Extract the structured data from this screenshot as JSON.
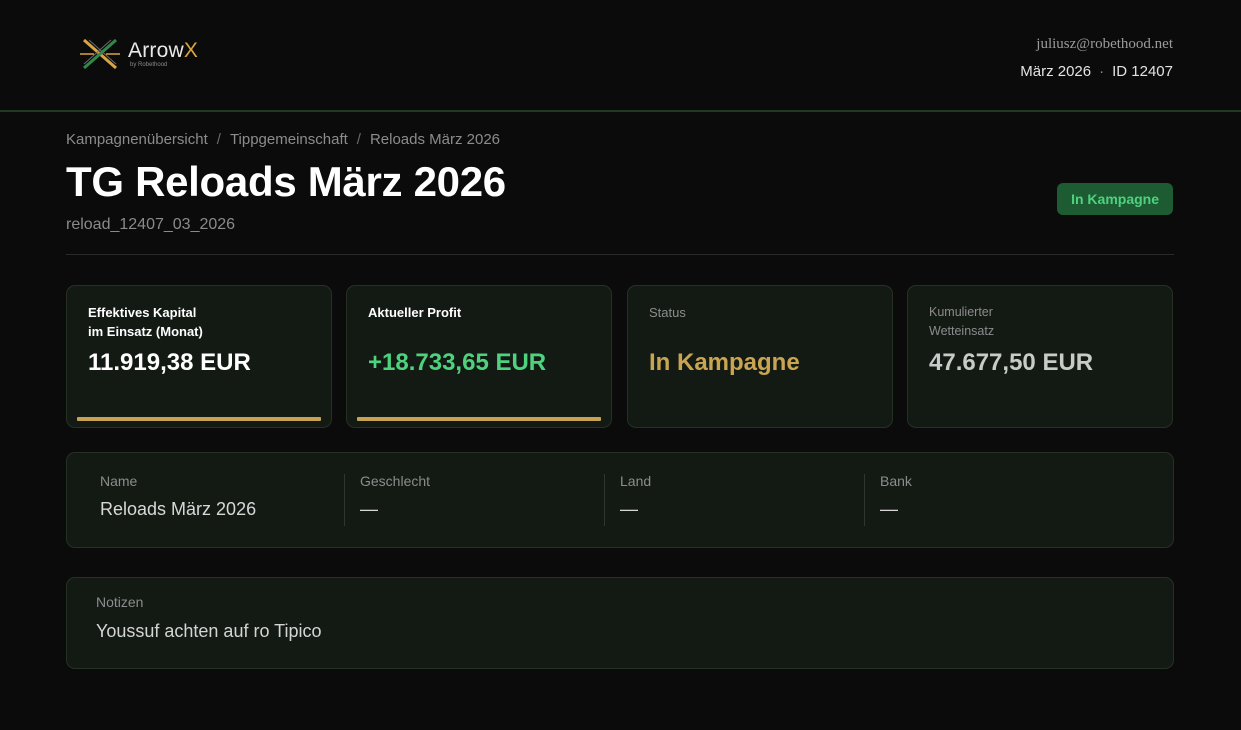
{
  "brand": {
    "name_main": "Arrow",
    "name_accent": "X",
    "tagline": "by Robethood",
    "colors": {
      "accent": "#d9a441",
      "green": "#4fd27e",
      "gold": "#c7a253"
    }
  },
  "user": {
    "email": "juliusz@robethood.net",
    "period": "März 2026",
    "separator": "·",
    "id": "ID 12407"
  },
  "breadcrumb": [
    "Kampagnenübersicht",
    "Tippgemeinschaft",
    "Reloads März 2026"
  ],
  "page": {
    "title": "TG Reloads März 2026",
    "slug": "reload_12407_03_2026",
    "status_badge": "In Kampagne"
  },
  "cards": [
    {
      "label_line1": "Effektives Kapital",
      "label_line2": "im Einsatz (Monat)",
      "value": "11.919,38 EUR",
      "value_color": "#ffffff"
    },
    {
      "label_line1": "Aktueller Profit",
      "value": "+18.733,65 EUR",
      "value_color": "#4fd27e"
    },
    {
      "label_line1": "Status",
      "value": "In Kampagne",
      "value_color": "#c9a552"
    },
    {
      "label_line1": "Kumulierter",
      "label_line2": "Wetteinsatz",
      "value": "47.677,50 EUR",
      "value_color": "#c8ccc8"
    }
  ],
  "info": {
    "fields": [
      {
        "label": "Name",
        "value": "Reloads März 2026"
      },
      {
        "label": "Geschlecht",
        "value": "—"
      },
      {
        "label": "Land",
        "value": "—"
      },
      {
        "label": "Bank",
        "value": "—"
      }
    ]
  },
  "notes": {
    "label": "Notizen",
    "value": "Youssuf achten auf ro Tipico"
  }
}
